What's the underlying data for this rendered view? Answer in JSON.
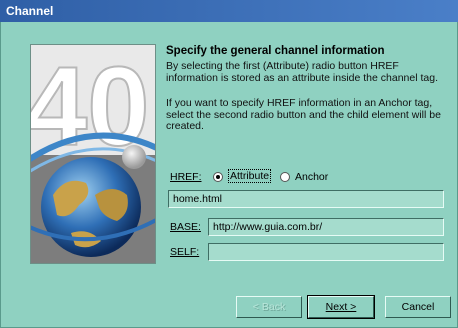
{
  "window": {
    "title": "Channel"
  },
  "main": {
    "heading": "Specify the general channel information",
    "paragraph1": "By selecting the first (Attribute) radio button HREF information is stored as an attribute inside the channel tag.",
    "paragraph2": "If you want to specify HREF information in an Anchor tag, select the second radio button and the child element will be created."
  },
  "form": {
    "href_label": "HREF:",
    "radio_attribute_label": "Attribute",
    "radio_anchor_label": "Anchor",
    "selected_radio": "Attribute",
    "href_value": "home.html",
    "base_label": "BASE:",
    "base_value": "http://www.guia.com.br/",
    "self_label": "SELF:",
    "self_value": ""
  },
  "buttons": {
    "back": "< Back",
    "next": "Next >",
    "cancel": "Cancel"
  },
  "side_image": {
    "graphic_text": "40"
  },
  "colors": {
    "dialog_bg": "#8fd1c1",
    "title_bar": "#2f5fa6",
    "field_bg": "#a5dccd"
  }
}
